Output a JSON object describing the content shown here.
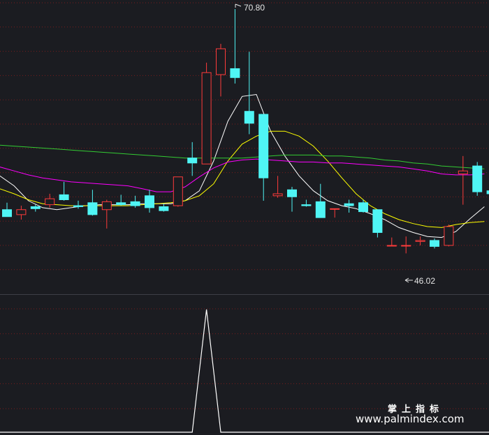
{
  "chart_data": {
    "type": "candlestick",
    "price_range": [
      42.3,
      71.5
    ],
    "candles": [
      {
        "o": 50.6,
        "h": 51.3,
        "l": 49.9,
        "c": 49.9
      },
      {
        "o": 50.1,
        "h": 51.0,
        "l": 49.6,
        "c": 50.6
      },
      {
        "o": 50.9,
        "h": 51.1,
        "l": 50.4,
        "c": 50.7
      },
      {
        "o": 51.1,
        "h": 52.2,
        "l": 50.8,
        "c": 51.7
      },
      {
        "o": 52.1,
        "h": 53.4,
        "l": 51.5,
        "c": 51.6
      },
      {
        "o": 51.0,
        "h": 51.5,
        "l": 50.7,
        "c": 50.9
      },
      {
        "o": 51.3,
        "h": 52.6,
        "l": 50.0,
        "c": 50.1
      },
      {
        "o": 50.6,
        "h": 51.6,
        "l": 48.7,
        "c": 51.4
      },
      {
        "o": 51.3,
        "h": 52.1,
        "l": 51.0,
        "c": 51.1
      },
      {
        "o": 51.4,
        "h": 52.0,
        "l": 50.8,
        "c": 51.0
      },
      {
        "o": 52.0,
        "h": 52.6,
        "l": 50.3,
        "c": 50.8
      },
      {
        "o": 50.9,
        "h": 51.2,
        "l": 50.4,
        "c": 50.5
      },
      {
        "o": 51.0,
        "h": 53.9,
        "l": 50.9,
        "c": 53.9
      },
      {
        "o": 55.8,
        "h": 57.4,
        "l": 54.0,
        "c": 55.3
      },
      {
        "o": 55.2,
        "h": 65.4,
        "l": 55.2,
        "c": 64.4
      },
      {
        "o": 64.2,
        "h": 67.3,
        "l": 62.0,
        "c": 66.8
      },
      {
        "o": 64.8,
        "h": 70.8,
        "l": 63.3,
        "c": 63.9
      },
      {
        "o": 60.5,
        "h": 66.5,
        "l": 58.2,
        "c": 59.3
      },
      {
        "o": 60.2,
        "h": 60.2,
        "l": 51.5,
        "c": 53.8
      },
      {
        "o": 52.0,
        "h": 54.0,
        "l": 51.8,
        "c": 52.2
      },
      {
        "o": 52.6,
        "h": 52.9,
        "l": 50.4,
        "c": 51.9
      },
      {
        "o": 51.1,
        "h": 51.6,
        "l": 50.9,
        "c": 51.0
      },
      {
        "o": 51.4,
        "h": 53.2,
        "l": 49.8,
        "c": 49.8
      },
      {
        "o": 50.7,
        "h": 50.7,
        "l": 49.8,
        "c": 50.7
      },
      {
        "o": 51.2,
        "h": 51.6,
        "l": 50.3,
        "c": 51.0
      },
      {
        "o": 51.3,
        "h": 51.6,
        "l": 50.3,
        "c": 50.4
      },
      {
        "o": 50.6,
        "h": 50.6,
        "l": 47.8,
        "c": 48.3
      },
      {
        "o": 47.0,
        "h": 47.8,
        "l": 46.9,
        "c": 47.0
      },
      {
        "o": 47.0,
        "h": 47.9,
        "l": 46.2,
        "c": 47.0
      },
      {
        "o": 47.4,
        "h": 47.9,
        "l": 47.0,
        "c": 47.5
      },
      {
        "o": 47.5,
        "h": 47.7,
        "l": 46.7,
        "c": 46.9
      },
      {
        "o": 47.0,
        "h": 49.1,
        "l": 46.9,
        "c": 48.9
      },
      {
        "o": 54.2,
        "h": 56.0,
        "l": 51.1,
        "c": 54.5
      },
      {
        "o": 55.0,
        "h": 55.4,
        "l": 52.0,
        "c": 52.4
      },
      {
        "o": 52.5,
        "h": 53.2,
        "l": 51.8,
        "c": 52.2
      }
    ],
    "moving_averages": [
      {
        "color": "#ffffff",
        "values": [
          54.0,
          53.0,
          51.5,
          50.8,
          50.6,
          50.8,
          51.0,
          51.1,
          51.1,
          51.1,
          51.2,
          51.2,
          51.2,
          51.5,
          52.5,
          55.5,
          59.5,
          62.0,
          62.2,
          58.5,
          56.0,
          54.0,
          52.5,
          51.5,
          51.0,
          50.7,
          50.2,
          49.6,
          48.8,
          48.3,
          47.9,
          47.8,
          48.4,
          49.7,
          50.9
        ]
      },
      {
        "color": "#ffff00",
        "values": [
          52.7,
          52.2,
          51.6,
          51.2,
          51.1,
          51.0,
          51.0,
          51.0,
          51.0,
          51.0,
          51.1,
          51.2,
          51.3,
          51.5,
          52.0,
          53.2,
          55.5,
          57.2,
          58.0,
          58.5,
          58.5,
          58.0,
          57.0,
          55.5,
          53.8,
          52.2,
          51.0,
          50.2,
          49.6,
          49.2,
          48.9,
          48.8,
          49.1,
          49.3,
          49.4
        ]
      },
      {
        "color": "#ff00ff",
        "values": [
          54.9,
          54.5,
          54.1,
          53.8,
          53.6,
          53.4,
          53.3,
          53.2,
          53.1,
          53.0,
          52.7,
          52.4,
          52.4,
          52.9,
          53.9,
          54.8,
          55.4,
          55.6,
          55.7,
          55.6,
          55.5,
          55.4,
          55.4,
          55.3,
          55.3,
          55.2,
          55.1,
          55.0,
          54.9,
          54.7,
          54.5,
          54.2,
          54.1,
          54.1,
          54.2
        ]
      },
      {
        "color": "#33cc33",
        "values": [
          57.1,
          57.0,
          56.9,
          56.8,
          56.7,
          56.6,
          56.5,
          56.4,
          56.3,
          56.2,
          56.1,
          56.0,
          55.9,
          55.8,
          55.8,
          55.8,
          55.8,
          55.8,
          55.9,
          56.0,
          56.1,
          56.1,
          56.1,
          56.0,
          56.0,
          55.9,
          55.8,
          55.6,
          55.5,
          55.3,
          55.2,
          55.0,
          54.9,
          54.8,
          54.7
        ]
      }
    ],
    "annotations": {
      "high": "70.80",
      "low": "46.02"
    },
    "indicator": {
      "range": [
        0,
        1
      ],
      "values": [
        0,
        0,
        0,
        0,
        0,
        0,
        0,
        0,
        0,
        0,
        0,
        0,
        0,
        0,
        1,
        0,
        0,
        0,
        0,
        0,
        0,
        0,
        0,
        0,
        0,
        0,
        0,
        0,
        0,
        0,
        0,
        0,
        0,
        0,
        0
      ]
    },
    "grid": true
  },
  "watermark": {
    "brand": "掌上指标",
    "url": "www.palmindex.com"
  },
  "colors": {
    "background": "#1b1c21",
    "rise": "#ff3b3b",
    "fall": "#4ff5f5",
    "grid": "#7a1d1d"
  }
}
